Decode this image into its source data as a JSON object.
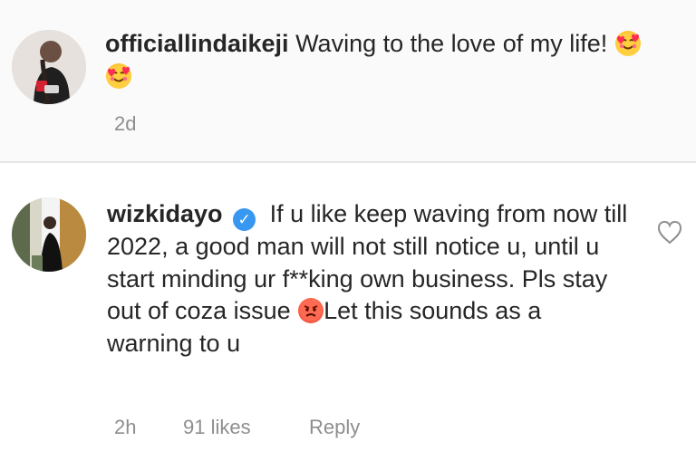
{
  "post": {
    "username": "officiallindaikeji",
    "caption": "Waving to the love of my life!",
    "emojis": [
      "smiling-face-with-hearts",
      "smiling-face-with-hearts"
    ],
    "time": "2d"
  },
  "comment": {
    "username": "wizkidayo",
    "verified": true,
    "text_before_emoji": "If u like keep waving from now till 2022, a good man will not still notice u, until u start minding ur f**king own business. Pls stay out of coza issue",
    "emoji": "angry-face",
    "text_after_emoji": "Let this sounds as a warning to u",
    "time": "2h",
    "likes": "91 likes",
    "reply_label": "Reply"
  },
  "icons": {
    "heart": "heart-outline-icon",
    "verified": "verified-badge-icon"
  },
  "colors": {
    "username": "#262626",
    "meta": "#8e8e8e",
    "verified": "#3897f0",
    "divider": "#e6e6e6",
    "post_background": "#fafafa"
  }
}
